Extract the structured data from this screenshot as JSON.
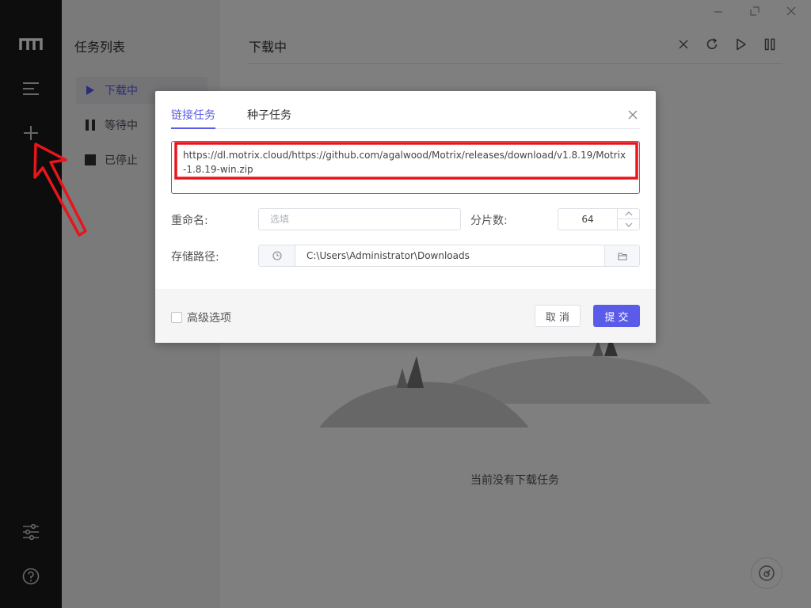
{
  "sidebar": {
    "icons": [
      "motrix-logo-icon",
      "menu-list-icon",
      "add-task-icon",
      "preferences-sliders-icon",
      "help-icon"
    ]
  },
  "tasklist": {
    "title": "任务列表",
    "items": [
      {
        "label": "下载中",
        "icon": "play-icon",
        "active": true
      },
      {
        "label": "等待中",
        "icon": "pause-icon",
        "active": false
      },
      {
        "label": "已停止",
        "icon": "stop-icon",
        "active": false
      }
    ]
  },
  "main": {
    "title": "下载中",
    "empty_text": "当前没有下载任务",
    "toolbar": [
      "close-icon",
      "refresh-icon",
      "resume-all-icon",
      "pause-all-icon"
    ]
  },
  "dialog": {
    "tabs": [
      {
        "label": "链接任务",
        "active": true
      },
      {
        "label": "种子任务",
        "active": false
      }
    ],
    "url_value": "https://dl.motrix.cloud/https://github.com/agalwood/Motrix/releases/download/v1.8.19/Motrix-1.8.19-win.zip",
    "rename_label": "重命名:",
    "rename_placeholder": "选填",
    "split_label": "分片数:",
    "split_value": "64",
    "path_label": "存储路径:",
    "path_value": "C:\\Users\\Administrator\\Downloads",
    "advanced_label": "高级选项",
    "cancel_label": "取 消",
    "submit_label": "提 交"
  },
  "colors": {
    "accent": "#5b5bea",
    "sidebar_bg": "#1b1b1b",
    "highlight": "#e8151b"
  }
}
